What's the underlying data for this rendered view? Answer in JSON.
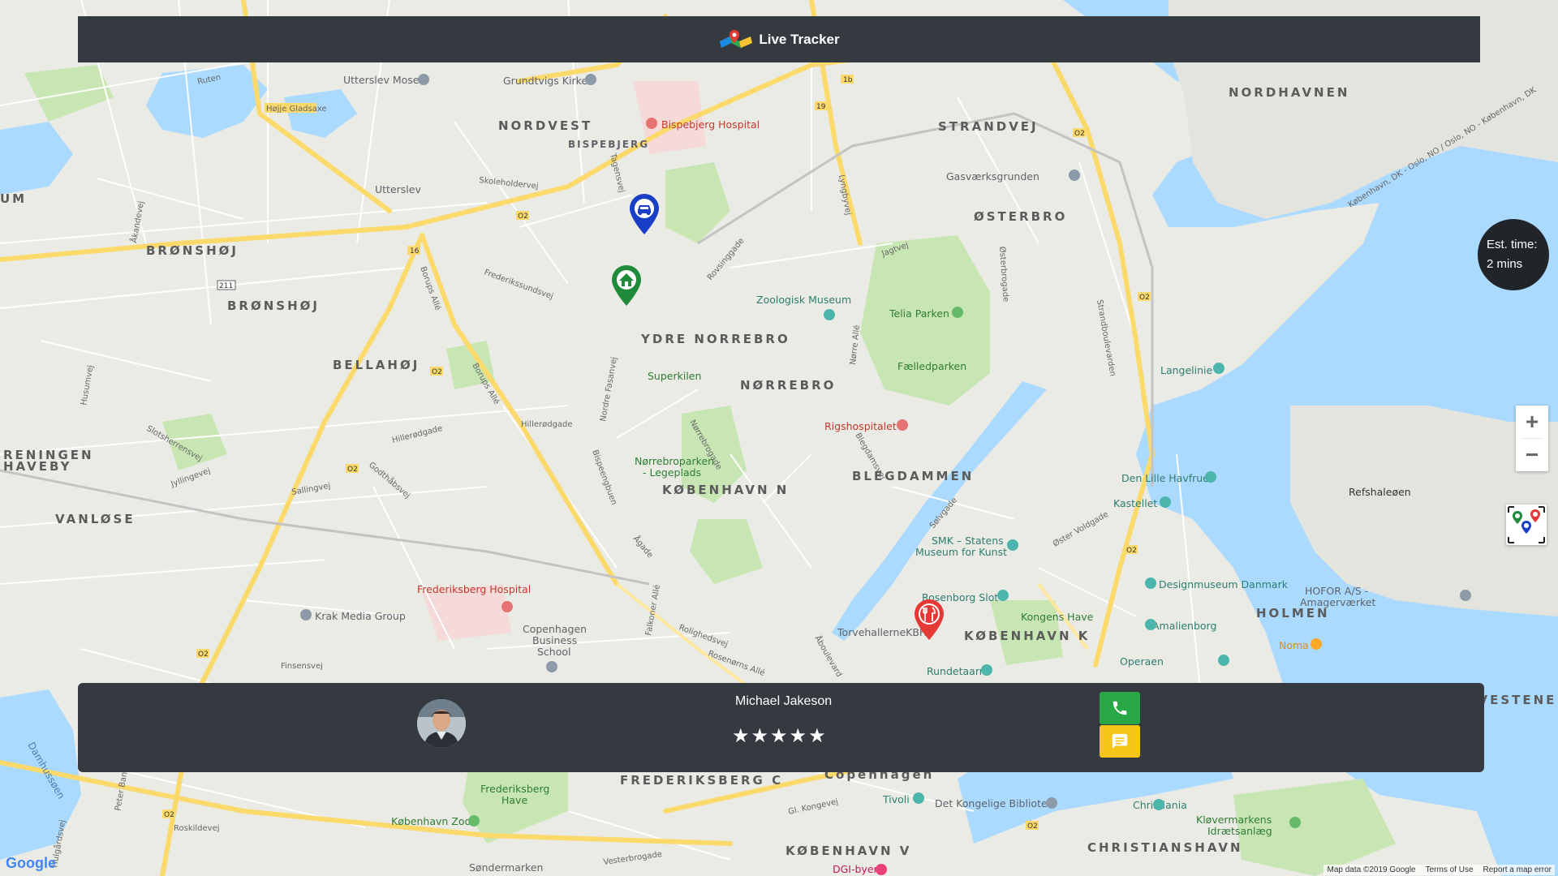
{
  "header": {
    "brand_name": "Live Tracker"
  },
  "eta": {
    "line1": "Est. time:",
    "line2": "2 mins"
  },
  "zoom": {
    "in_label": "+",
    "out_label": "−"
  },
  "driver": {
    "name": "Michael Jakeson",
    "rating": 5,
    "stars": [
      "★",
      "★",
      "★",
      "★",
      "★"
    ]
  },
  "map": {
    "districts": [
      "NORDVEST",
      "BISPEBJERG",
      "STRANDVEJ",
      "NORDHAVNEN",
      "ØSTERBRO",
      "BRØNSHØJ",
      "BRØNSHØJ",
      "BELLAHØJ",
      "YDRE NORREBRO",
      "NØRREBRO",
      "RENINGEN",
      "HAVEBY",
      "VANLØSE",
      "KØBENHAVN N",
      "BLEGDAMMEN",
      "KØBENHAVN K",
      "HOLMEN",
      "FREDERIKSBERG C",
      "KØBENHAVN V",
      "CHRISTIANSHAVN",
      "Copenhagen",
      "Frederiksberg",
      "UM",
      "ØVESTENE"
    ],
    "places": [
      "Utterslev Mose",
      "Grundtvigs Kirke",
      "Bispebjerg Hospital",
      "Utterslev",
      "Gasværksgrunden",
      "Zoologisk Museum",
      "Telia Parken",
      "Fælledparken",
      "Langelinie",
      "Superkilen",
      "Rigshospitalet",
      "Nørrebroparken - Legeplads",
      "Den Lille Havfrue",
      "Refshaleøen",
      "Kastellet",
      "SMK – Statens Museum for Kunst",
      "Rosenborg Slot",
      "Designmuseum Danmark",
      "HOFOR A/S - Amagerværket",
      "Kongens Have",
      "Amalienborg",
      "Frederiksberg Hospital",
      "Krak Media Group",
      "Copenhagen Business School",
      "TorvehallerneKBH",
      "Rundetaarn",
      "Operaen",
      "Noma",
      "Frederiksberg Have",
      "København Zoo",
      "Tivoli",
      "Det Kongelige Bibliotek",
      "Christiania",
      "Kløvermarkens Idrætsanlæg",
      "Søndermarken",
      "DGI-byen",
      "Højje Gladsaxe"
    ],
    "streets": [
      "Ruten",
      "Skoleholdervej",
      "Frederikssundsvej",
      "Borups Allé",
      "Hillerødgade",
      "Nordre Fasanvej",
      "Bispeengbuen",
      "Jagtvej",
      "Lyngbyvej",
      "Østerbrogade",
      "Strandboulevarden",
      "Tagensvej",
      "Nørre Allé",
      "Falkoner Allé",
      "Åboulevard",
      "Roskildevej",
      "Vesterbrogade",
      "Gl. Kongevej",
      "Slotsherrensvej",
      "Jyllingevej",
      "Godthåbsvej",
      "Sallingvej",
      "Finsensvej",
      "Rolighedsvej",
      "Rosenørns Allé",
      "Øster Voldgade",
      "Sølvgade",
      "Peter Bangs Vej",
      "Damhussøen",
      "Hulgårdsvej",
      "Husumvej",
      "Åkandevej",
      "Rovsinggade",
      "Blegdamsvej",
      "Nørrebrogade",
      "Ågade",
      "København, DK - Oslo, NO / Oslo, NO - København, DK"
    ],
    "road_numbers": [
      "O2",
      "16",
      "211",
      "19",
      "1b",
      "O2"
    ],
    "attribution": "Google",
    "footer_links": [
      "Map data ©2019 Google",
      "Terms of Use",
      "Report a map error"
    ]
  },
  "colors": {
    "header_bg": "#343a40",
    "panel_bg": "#343a40",
    "eta_bg": "#212529",
    "call_green": "#28a745",
    "message_yellow": "#f5c518",
    "marker_blue": "#1a3fc7",
    "marker_green": "#1f8a3a",
    "marker_red": "#e53935",
    "water": "#aadaff",
    "park": "#c8e6b4"
  },
  "icons": {
    "brand": "folded-map-icon",
    "car_marker": "car-marker-icon",
    "home_marker": "home-marker-icon",
    "restaurant_marker": "restaurant-marker-icon",
    "call": "phone-icon",
    "message": "chat-icon",
    "fit": "fit-markers-icon"
  }
}
